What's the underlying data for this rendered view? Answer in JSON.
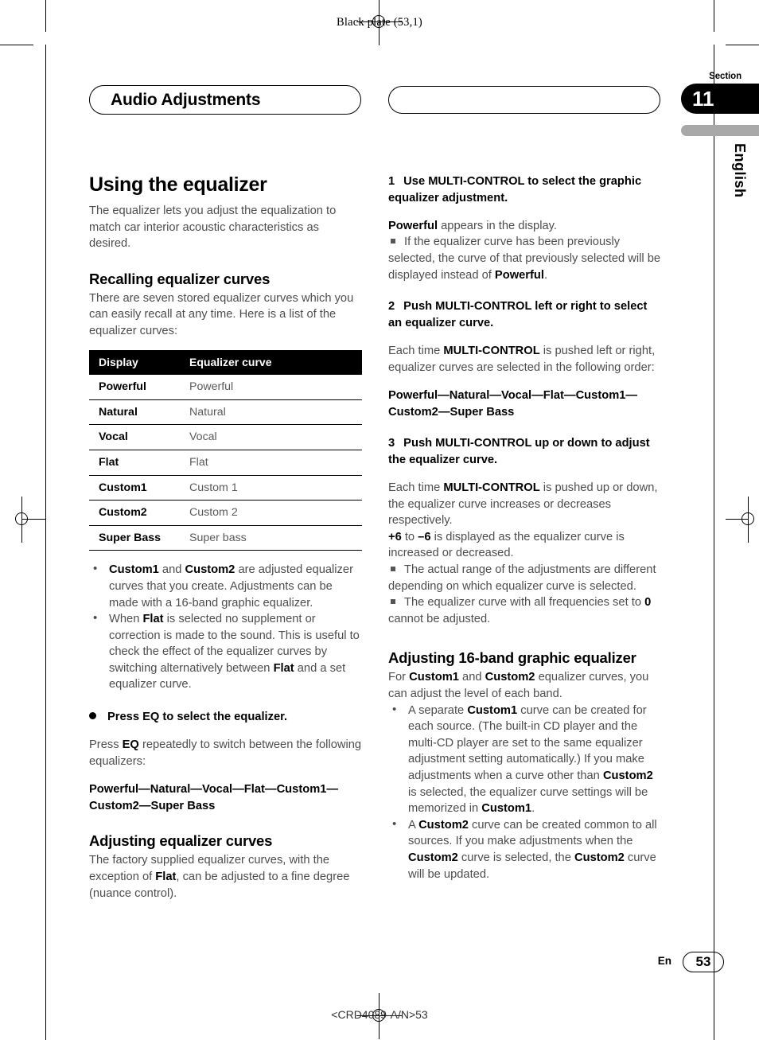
{
  "page": {
    "running_head": "Black plate (53,1)",
    "chapter_title": "Audio Adjustments",
    "section_label": "Section",
    "section_number": "11",
    "language_tab": "English",
    "footer_lang": "En",
    "footer_page": "53",
    "footer_code": "<CRD4089-A/N>53",
    "accent_black": "#000000",
    "tab_grey": "#a8a8a8",
    "body_grey": "#4d4d4d"
  },
  "left": {
    "title": "Using the equalizer",
    "intro": "The equalizer lets you adjust the equalization to match car interior acoustic characteristics as desired.",
    "recalling": {
      "heading": "Recalling equalizer curves",
      "intro": "There are seven stored equalizer curves which you can easily recall at any time. Here is a list of the equalizer curves:",
      "table": {
        "headers": [
          "Display",
          "Equalizer curve"
        ],
        "rows": [
          [
            "Powerful",
            "Powerful"
          ],
          [
            "Natural",
            "Natural"
          ],
          [
            "Vocal",
            "Vocal"
          ],
          [
            "Flat",
            "Flat"
          ],
          [
            "Custom1",
            "Custom 1"
          ],
          [
            "Custom2",
            "Custom 2"
          ],
          [
            "Super Bass",
            "Super bass"
          ]
        ]
      },
      "bullets": [
        "Custom1 and Custom2 are adjusted equalizer curves that you create. Adjustments can be made with a 16-band graphic equalizer.",
        "When Flat is selected no supplement or correction is made to the sound. This is useful to check the effect of the equalizer curves by switching alternatively between Flat and a set equalizer curve."
      ],
      "operation_heading": "Press EQ to select the equalizer.",
      "operation_body": "Press EQ repeatedly to switch between the following equalizers:",
      "operation_sequence": "Powerful—Natural—Vocal—Flat—Custom1—Custom2—Super Bass"
    },
    "adjusting": {
      "heading": "Adjusting equalizer curves",
      "body": "The factory supplied equalizer curves, with the exception of Flat, can be adjusted to a fine degree (nuance control)."
    }
  },
  "right": {
    "steps": [
      {
        "num": "1",
        "heading": "Use MULTI-CONTROL to select the graphic equalizer adjustment.",
        "body": "Powerful appears in the display.",
        "notes": [
          "If the equalizer curve has been previously selected, the curve of that previously selected will be displayed instead of Powerful."
        ]
      },
      {
        "num": "2",
        "heading": "Push MULTI-CONTROL left or right to select an equalizer curve.",
        "body": "Each time MULTI-CONTROL is pushed left or right, equalizer curves are selected in the following order:",
        "sequence": "Powerful—Natural—Vocal—Flat—Custom1—Custom2—Super Bass",
        "notes": []
      },
      {
        "num": "3",
        "heading": "Push MULTI-CONTROL up or down to adjust the equalizer curve.",
        "body": "Each time MULTI-CONTROL is pushed up or down, the equalizer curve increases or decreases respectively.",
        "body2": "+6 to –6 is displayed as the equalizer curve is increased or decreased.",
        "notes": [
          "The actual range of the adjustments are different depending on which equalizer curve is selected.",
          "The equalizer curve with all frequencies set to 0 cannot be adjusted."
        ]
      }
    ],
    "graphic_eq": {
      "heading": "Adjusting 16-band graphic equalizer",
      "intro": "For Custom1 and Custom2 equalizer curves, you can adjust the level of each band.",
      "bullets": [
        "A separate Custom1 curve can be created for each source. (The built-in CD player and the multi-CD player are set to the same equalizer adjustment setting automatically.) If you make adjustments when a curve other than Custom2 is selected, the equalizer curve settings will be memorized in Custom1.",
        "A Custom2 curve can be created common to all sources. If you make adjustments when the Custom2 curve is selected, the Custom2 curve will be updated."
      ]
    }
  }
}
